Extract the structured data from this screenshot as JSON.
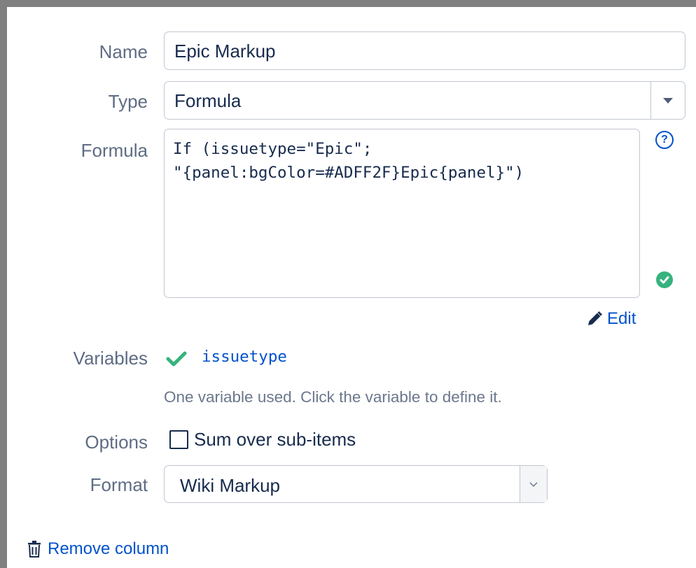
{
  "form": {
    "name": {
      "label": "Name",
      "value": "Epic Markup"
    },
    "type": {
      "label": "Type",
      "value": "Formula"
    },
    "formula": {
      "label": "Formula",
      "lines": [
        "If (issuetype=\"Epic\";",
        "\"{panel:bgColor=#ADFF2F}Epic{panel}\")"
      ],
      "help_icon": "question-circle-icon",
      "status_icon": "check-circle-icon",
      "edit_label": "Edit",
      "edit_icon": "pencil-icon"
    },
    "variables": {
      "label": "Variables",
      "items": [
        {
          "name": "issuetype",
          "status_icon": "checkmark-icon"
        }
      ],
      "hint": "One variable used. Click the variable to define it."
    },
    "options": {
      "label": "Options",
      "sum_over_subitems": {
        "label": "Sum over sub-items",
        "checked": false
      }
    },
    "format": {
      "label": "Format",
      "value": "Wiki Markup"
    }
  },
  "actions": {
    "remove_column": {
      "label": "Remove column",
      "icon": "trash-icon"
    }
  },
  "colors": {
    "link": "#0052cc",
    "success": "#36b37e",
    "label": "#5e6c84",
    "border": "#c1c7d0",
    "frame": "#808080"
  }
}
